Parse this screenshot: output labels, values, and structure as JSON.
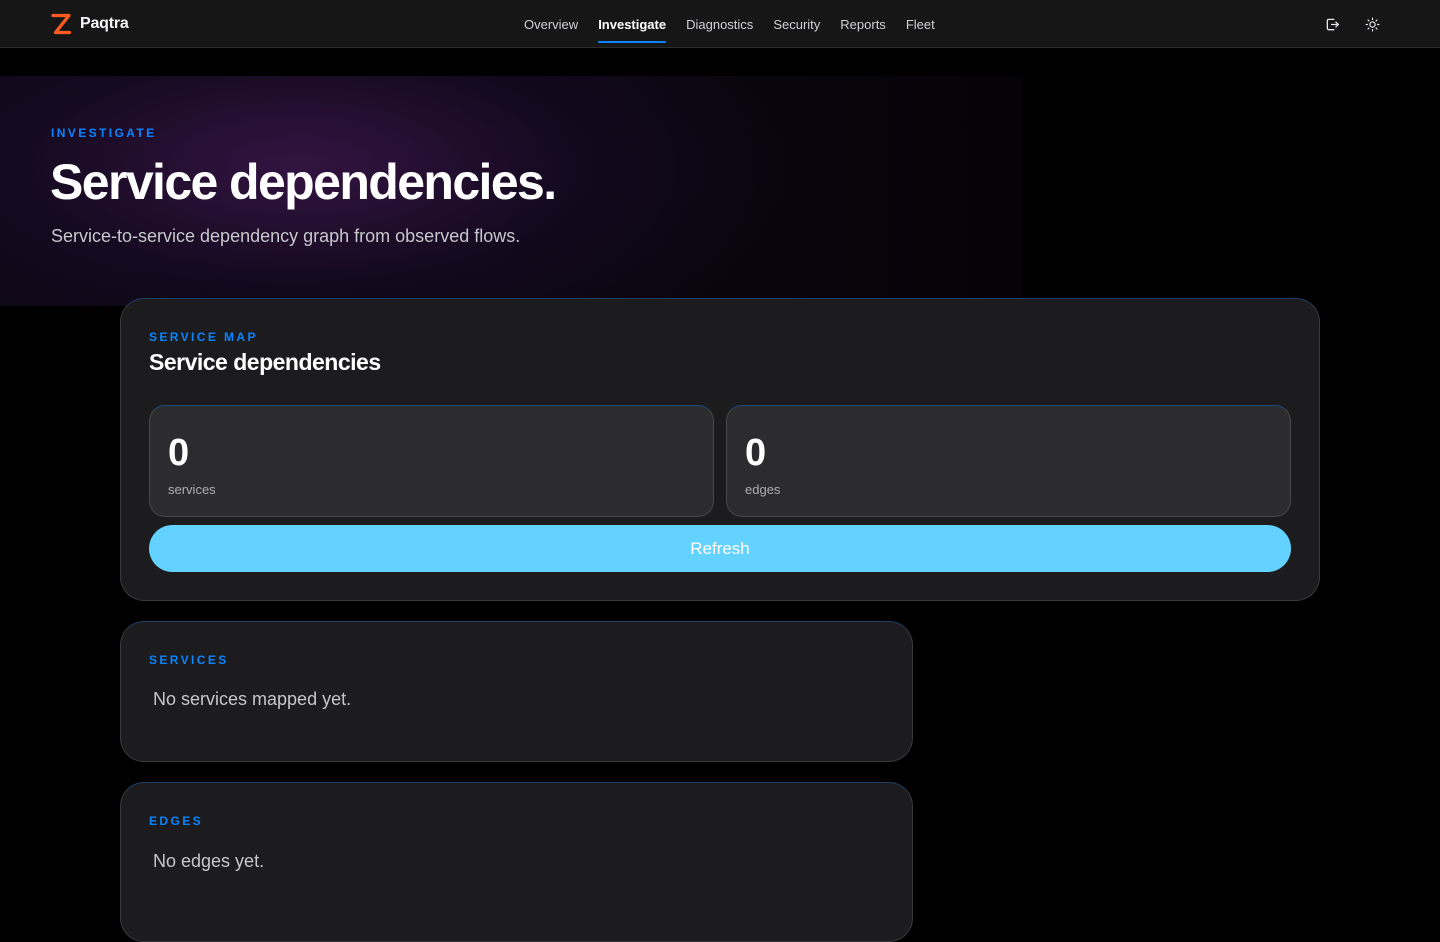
{
  "app": {
    "name": "Paqtra"
  },
  "nav": {
    "items": [
      {
        "label": "Overview"
      },
      {
        "label": "Investigate"
      },
      {
        "label": "Diagnostics"
      },
      {
        "label": "Security"
      },
      {
        "label": "Reports"
      },
      {
        "label": "Fleet"
      }
    ],
    "active": "Investigate"
  },
  "header_actions": {
    "icons": [
      "logout-icon",
      "theme-toggle-icon"
    ]
  },
  "hero": {
    "eyebrow": "INVESTIGATE",
    "title": "Service dependencies.",
    "subtitle": "Service-to-service dependency graph from observed flows."
  },
  "service_map": {
    "eyebrow": "SERVICE MAP",
    "title": "Service dependencies",
    "stats": [
      {
        "value": "0",
        "label": "services"
      },
      {
        "value": "0",
        "label": "edges"
      }
    ],
    "refresh_label": "Refresh"
  },
  "services": {
    "eyebrow": "SERVICES",
    "empty_text": "No services mapped yet."
  },
  "edges": {
    "eyebrow": "EDGES",
    "empty_text": "No edges yet."
  },
  "colors": {
    "accent": "#0a84ff",
    "brand": "#ff5a1f",
    "button": "#64d2ff",
    "surface": "#1c1c1e",
    "background": "#000000"
  }
}
